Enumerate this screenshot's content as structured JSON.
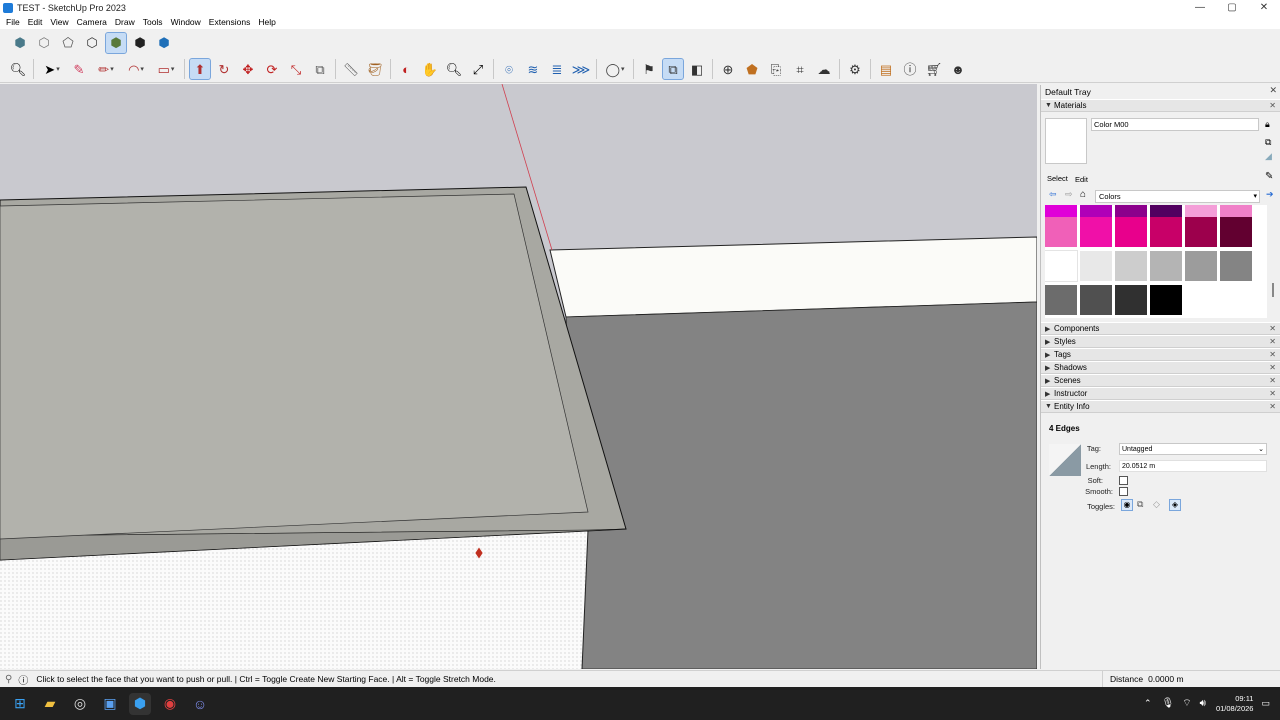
{
  "window": {
    "title": "TEST - SketchUp Pro 2023",
    "min": "—",
    "max": "▢",
    "close": "✕"
  },
  "menu": [
    "File",
    "Edit",
    "View",
    "Camera",
    "Draw",
    "Tools",
    "Window",
    "Extensions",
    "Help"
  ],
  "tray": {
    "title": "Default Tray",
    "materials": {
      "header": "Materials",
      "name": "Color M00",
      "tab_select": "Select",
      "tab_edit": "Edit",
      "collection": "Colors",
      "swatches": [
        [
          "#e000d8",
          "#b000b8",
          "#8c008c",
          "#520060",
          "#f49ed8",
          "#f080c8"
        ],
        [
          "#f060b8",
          "#f010a8",
          "#e8008c",
          "#c80068",
          "#9c004c",
          "#620030"
        ],
        [
          "#ffffff",
          "#e8e8e8",
          "#cdcdcd",
          "#b4b4b4",
          "#9c9c9c",
          "#848484"
        ],
        [
          "#6c6c6c",
          "#505050",
          "#303030",
          "#000000"
        ]
      ]
    },
    "panels": [
      "Components",
      "Styles",
      "Tags",
      "Shadows",
      "Scenes",
      "Instructor",
      "Entity Info"
    ],
    "entity_info": {
      "summary": "4 Edges",
      "tag_label": "Tag:",
      "tag_value": "Untagged",
      "length_label": "Length:",
      "length_value": "20.0512 m",
      "soft_label": "Soft:",
      "smooth_label": "Smooth:",
      "toggles_label": "Toggles:"
    }
  },
  "status": {
    "message": "Click to select the face that you want to push or pull. | Ctrl = Toggle Create New Starting Face. | Alt = Toggle Stretch Mode.",
    "measurement_label": "Distance",
    "measurement_value": "0.0000 m"
  },
  "taskbar": {
    "time": "09:11",
    "date": "01/08/2026"
  }
}
